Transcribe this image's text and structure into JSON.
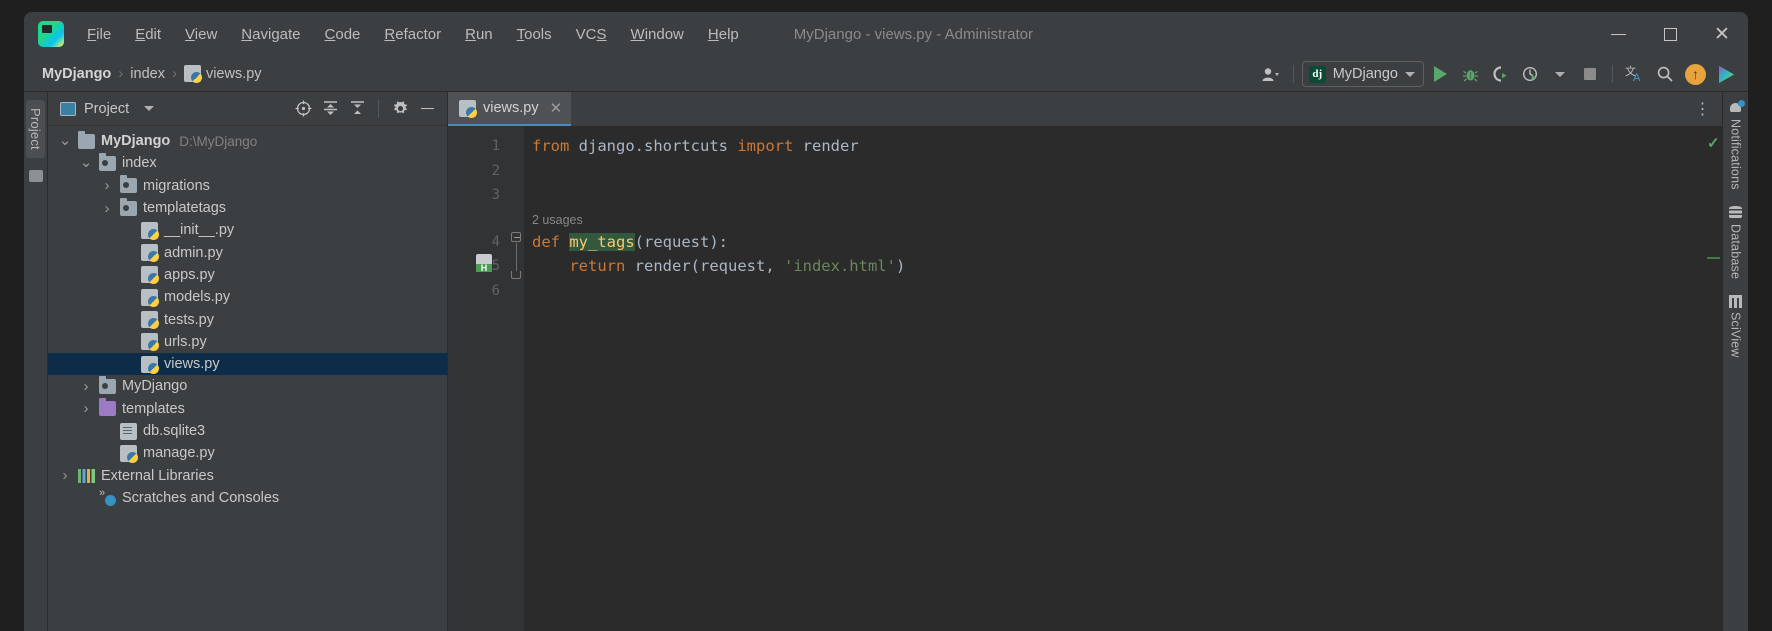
{
  "window": {
    "title": "MyDjango - views.py - Administrator",
    "logo_icon": "pycharm-logo-icon",
    "controls": {
      "minimize": "minimize-icon",
      "maximize": "maximize-icon",
      "close": "close-icon"
    }
  },
  "menubar": {
    "items": [
      {
        "label": "File",
        "mnemonic": "F",
        "rest": "ile"
      },
      {
        "label": "Edit",
        "mnemonic": "E",
        "rest": "dit"
      },
      {
        "label": "View",
        "mnemonic": "V",
        "rest": "iew"
      },
      {
        "label": "Navigate",
        "mnemonic": "N",
        "rest": "avigate"
      },
      {
        "label": "Code",
        "mnemonic": "C",
        "rest": "ode"
      },
      {
        "label": "Refactor",
        "mnemonic": "R",
        "rest": "efactor"
      },
      {
        "label": "Run",
        "mnemonic": "R",
        "rest": "un"
      },
      {
        "label": "Tools",
        "mnemonic": "T",
        "rest": "ools"
      },
      {
        "label": "VCS",
        "mnemonic": "S",
        "rest": ""
      },
      {
        "label": "Window",
        "mnemonic": "W",
        "rest": "indow"
      },
      {
        "label": "Help",
        "mnemonic": "H",
        "rest": "elp"
      }
    ]
  },
  "breadcrumb": {
    "items": [
      {
        "label": "MyDjango",
        "icon": ""
      },
      {
        "label": "index",
        "icon": ""
      },
      {
        "label": "views.py",
        "icon": "python-file-icon"
      }
    ],
    "separator": "›"
  },
  "toolbar": {
    "account_icon": "user-account-icon",
    "run_config": {
      "label": "MyDjango",
      "badge": "dj",
      "dropdown_icon": "chevron-down-icon"
    },
    "buttons": [
      {
        "name": "run-button",
        "icon": "play-icon",
        "label": "Run"
      },
      {
        "name": "debug-button",
        "icon": "bug-icon",
        "label": "Debug"
      },
      {
        "name": "run-with-profiler-button",
        "icon": "profiler-icon",
        "label": "Profile"
      },
      {
        "name": "run-with-coverage-button",
        "icon": "coverage-icon",
        "label": "Coverage"
      },
      {
        "name": "stop-button",
        "icon": "stop-icon",
        "label": "Stop"
      },
      {
        "name": "translate-button",
        "icon": "translate-icon",
        "label": "Translate"
      },
      {
        "name": "search-everywhere-button",
        "icon": "search-icon",
        "label": "Search Everywhere"
      },
      {
        "name": "update-button",
        "icon": "update-arrow-icon",
        "label": "Update"
      },
      {
        "name": "plugin-button",
        "icon": "colorful-play-icon",
        "label": "Plugin"
      }
    ]
  },
  "left_strip": {
    "label": "Project"
  },
  "project_panel": {
    "header": {
      "title": "Project",
      "icon": "project-view-icon",
      "dropdown_icon": "chevron-down-icon"
    },
    "tools": [
      {
        "name": "select-opened-file-button",
        "icon": "crosshair-icon"
      },
      {
        "name": "expand-all-button",
        "icon": "expand-all-icon"
      },
      {
        "name": "collapse-all-button",
        "icon": "collapse-all-icon"
      },
      {
        "name": "settings-button",
        "icon": "gear-icon"
      },
      {
        "name": "hide-button",
        "icon": "minimize-icon"
      }
    ],
    "tree": [
      {
        "label": "MyDjango",
        "path": "D:\\MyDjango",
        "indent": 0,
        "arrow": "⌄",
        "icon": "folder",
        "bold": true,
        "selected": false
      },
      {
        "label": "index",
        "path": "",
        "indent": 1,
        "arrow": "⌄",
        "icon": "folder-module",
        "bold": false,
        "selected": false
      },
      {
        "label": "migrations",
        "path": "",
        "indent": 2,
        "arrow": "›",
        "icon": "folder-module",
        "bold": false,
        "selected": false
      },
      {
        "label": "templatetags",
        "path": "",
        "indent": 2,
        "arrow": "›",
        "icon": "folder-module",
        "bold": false,
        "selected": false
      },
      {
        "label": "__init__.py",
        "path": "",
        "indent": 3,
        "arrow": "",
        "icon": "python",
        "bold": false,
        "selected": false
      },
      {
        "label": "admin.py",
        "path": "",
        "indent": 3,
        "arrow": "",
        "icon": "python",
        "bold": false,
        "selected": false
      },
      {
        "label": "apps.py",
        "path": "",
        "indent": 3,
        "arrow": "",
        "icon": "python",
        "bold": false,
        "selected": false
      },
      {
        "label": "models.py",
        "path": "",
        "indent": 3,
        "arrow": "",
        "icon": "python",
        "bold": false,
        "selected": false
      },
      {
        "label": "tests.py",
        "path": "",
        "indent": 3,
        "arrow": "",
        "icon": "python",
        "bold": false,
        "selected": false
      },
      {
        "label": "urls.py",
        "path": "",
        "indent": 3,
        "arrow": "",
        "icon": "python",
        "bold": false,
        "selected": false
      },
      {
        "label": "views.py",
        "path": "",
        "indent": 3,
        "arrow": "",
        "icon": "python",
        "bold": false,
        "selected": true
      },
      {
        "label": "MyDjango",
        "path": "",
        "indent": 1,
        "arrow": "›",
        "icon": "folder-module",
        "bold": false,
        "selected": false
      },
      {
        "label": "templates",
        "path": "",
        "indent": 1,
        "arrow": "›",
        "icon": "folder-purple",
        "bold": false,
        "selected": false
      },
      {
        "label": "db.sqlite3",
        "path": "",
        "indent": 2,
        "arrow": "",
        "icon": "db",
        "bold": false,
        "selected": false
      },
      {
        "label": "manage.py",
        "path": "",
        "indent": 2,
        "arrow": "",
        "icon": "python",
        "bold": false,
        "selected": false
      },
      {
        "label": "External Libraries",
        "path": "",
        "indent": 0,
        "arrow": "›",
        "icon": "libs",
        "bold": false,
        "selected": false
      },
      {
        "label": "Scratches and Consoles",
        "path": "",
        "indent": 1,
        "arrow": "",
        "icon": "scratch",
        "bold": false,
        "selected": false
      }
    ]
  },
  "editor": {
    "tab": {
      "label": "views.py",
      "icon": "python-file-icon",
      "close_icon": "close-icon"
    },
    "more_icon": "more-options-icon",
    "line_numbers": [
      "1",
      "2",
      "3",
      "4",
      "5",
      "6"
    ],
    "inlay_hint": "2 usages",
    "gutter_icon_label": "H",
    "inspection_status_icon": "checkmark-ok-icon",
    "lines": [
      {
        "n": 1,
        "tokens": [
          {
            "t": "from",
            "c": "kw"
          },
          {
            "t": " ",
            "c": "id"
          },
          {
            "t": "django.shortcuts",
            "c": "id"
          },
          {
            "t": " ",
            "c": "id"
          },
          {
            "t": "import",
            "c": "kw"
          },
          {
            "t": " ",
            "c": "id"
          },
          {
            "t": "render",
            "c": "id"
          }
        ]
      },
      {
        "n": 2,
        "tokens": []
      },
      {
        "n": 3,
        "tokens": []
      },
      {
        "n": 4,
        "tokens": [
          {
            "t": "def",
            "c": "kw"
          },
          {
            "t": " ",
            "c": "id"
          },
          {
            "t": "my_tags",
            "c": "fn"
          },
          {
            "t": "(request):",
            "c": "id"
          }
        ]
      },
      {
        "n": 5,
        "tokens": [
          {
            "t": "    ",
            "c": "id"
          },
          {
            "t": "return",
            "c": "kw"
          },
          {
            "t": " ",
            "c": "id"
          },
          {
            "t": "render(request, ",
            "c": "id"
          },
          {
            "t": "'index.html'",
            "c": "str"
          },
          {
            "t": ")",
            "c": "id"
          }
        ]
      },
      {
        "n": 6,
        "tokens": []
      }
    ]
  },
  "right_strip": {
    "items": [
      {
        "label": "Notifications",
        "icon": "bell-icon"
      },
      {
        "label": "Database",
        "icon": "database-icon"
      },
      {
        "label": "SciView",
        "icon": "grid-icon"
      }
    ]
  },
  "colors": {
    "accent_blue": "#4a88c7",
    "selection": "#0d2c47",
    "keyword": "#cc7832",
    "string": "#6a8759",
    "function": "#ffc66d",
    "identifier": "#a9b7c6",
    "run_green": "#59a869",
    "update_orange": "#e8a33d"
  }
}
